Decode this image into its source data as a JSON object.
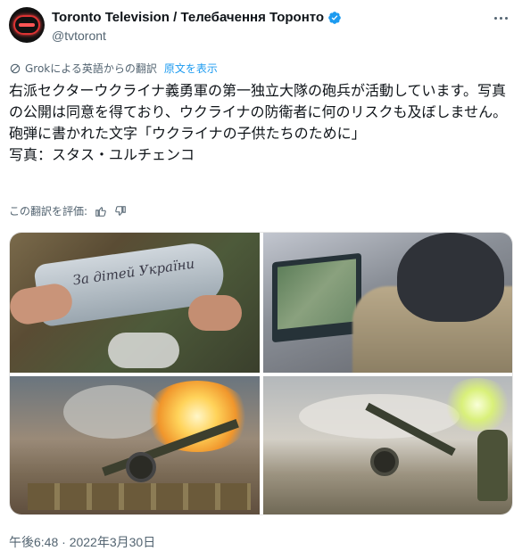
{
  "tweet": {
    "display_name": "Toronto Television / Телебачення Торонто",
    "handle": "@tvtoront",
    "verified": true,
    "avatar_icon": "neon-sign-avatar",
    "translation_note": "Grokによる英語からの翻訳",
    "show_original_label": "原文を表示",
    "text_lines": [
      "右派セクターウクライナ義勇軍の第一独立大隊の砲兵が活動しています。写真の公開は同意を得ており、ウクライナの防衛者に何のリスクも及ぼしません。",
      "砲弾に書かれた文字「ウクライナの子供たちのために」",
      "写真：スタス・ユルチェンコ"
    ],
    "rate_translation_label": "この翻訳を評価:",
    "shell_inscription": "За дітей України",
    "timestamp": "午後6:48 · 2022年3月30日"
  },
  "colors": {
    "text_primary": "#0f1419",
    "text_secondary": "#536471",
    "link": "#1d9bf0",
    "verified_badge": "#1d9bf0"
  }
}
